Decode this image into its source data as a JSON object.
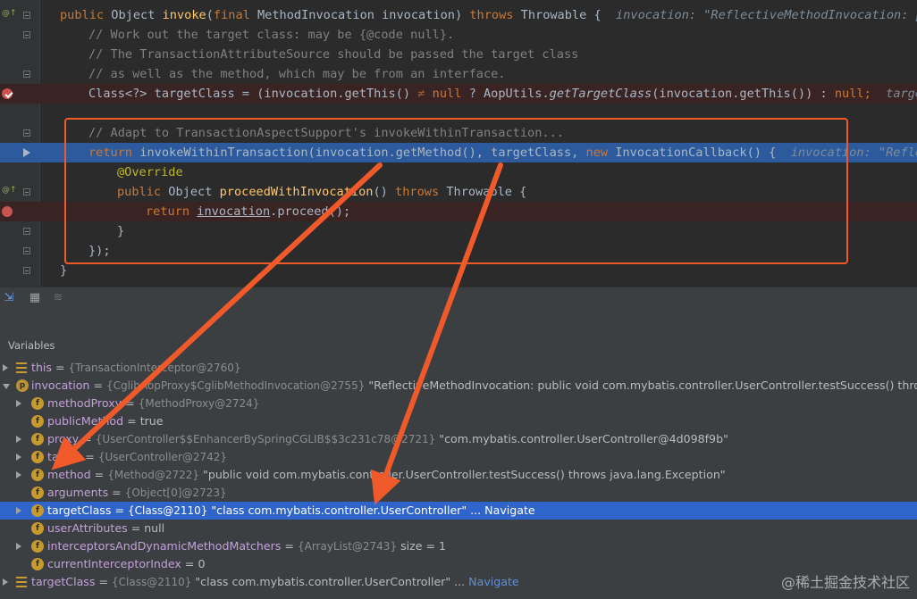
{
  "editor": {
    "lines": [
      {
        "id": "l1",
        "kw_public": "public",
        "type": " Object ",
        "method": "invoke",
        "open": "(",
        "kw_final": "final",
        "param": " MethodInvocation invocation) ",
        "kw_throws": "throws",
        "exc": " Throwable {",
        "hint": "  invocation: \"ReflectiveMethodInvocation: pub"
      },
      {
        "id": "l2",
        "text": "// Work out the target class: may be {@code null}."
      },
      {
        "id": "l3",
        "text": "// The TransactionAttributeSource should be passed the target class"
      },
      {
        "id": "l4",
        "text": "// as well as the method, which may be from an interface."
      },
      {
        "id": "l5",
        "a": "Class<?> targetClass = (invocation.getThis() ",
        "ne": "≠",
        "b": " ",
        "null": "null",
        "c": " ? AopUtils.",
        "m": "getTargetClass",
        "d": "(invocation.getThis()) : ",
        "null2": "null",
        "e": ";",
        "hint": "  targe"
      },
      {
        "id": "l6",
        "text": "// Adapt to TransactionAspectSupport's invokeWithinTransaction..."
      },
      {
        "id": "l7",
        "ret": "return",
        "a": " invokeWithinTransaction(invocation.getMethod(), targetClass, ",
        "kw_new": "new",
        "b": " InvocationCallback() {",
        "hint": "  invocation: \"Reflect"
      },
      {
        "id": "l8",
        "text": "@Override"
      },
      {
        "id": "l9",
        "kw_public": "public",
        "type": " Object ",
        "method": "proceedWithInvocation",
        "a": "() ",
        "kw_throws": "throws",
        "exc": " Throwable {"
      },
      {
        "id": "l10",
        "ret": "return",
        "sp": " ",
        "inv": "invocation",
        "a": ".proceed();"
      },
      {
        "id": "l11",
        "text": "}"
      },
      {
        "id": "l12",
        "text": "});"
      },
      {
        "id": "l13",
        "text": "}"
      }
    ]
  },
  "debug": {
    "variables_title": "Variables",
    "vars": [
      {
        "name": "this",
        "eq": " = ",
        "type": "{TransactionInterceptor@2760}",
        "value": ""
      },
      {
        "name": "invocation",
        "eq": " = ",
        "type": "{CglibAopProxy$CglibMethodInvocation@2755}",
        "value": " \"ReflectiveMethodInvocation: public void com.mybatis.controller.UserController.testSuccess() throws"
      },
      {
        "name": "methodProxy",
        "eq": " = ",
        "type": "{MethodProxy@2724}",
        "value": ""
      },
      {
        "name": "publicMethod",
        "eq": " = ",
        "type": "",
        "value": "true"
      },
      {
        "name": "proxy",
        "eq": " = ",
        "type": "{UserController$$EnhancerBySpringCGLIB$$3c231c78@2721}",
        "value": " \"com.mybatis.controller.UserController@4d098f9b\""
      },
      {
        "name": "target",
        "eq": " = ",
        "type": "{UserController@2742}",
        "value": ""
      },
      {
        "name": "method",
        "eq": " = ",
        "type": "{Method@2722}",
        "value": " \"public void com.mybatis.controller.UserController.testSuccess() throws java.lang.Exception\""
      },
      {
        "name": "arguments",
        "eq": " = ",
        "type": "{Object[0]@2723}",
        "value": ""
      },
      {
        "name": "targetClass",
        "eq": " = ",
        "type": "{Class@2110}",
        "value": " \"class com.mybatis.controller.UserController\" ...",
        "nav": " Navigate"
      },
      {
        "name": "userAttributes",
        "eq": " = ",
        "type": "",
        "value": "null"
      },
      {
        "name": "interceptorsAndDynamicMethodMatchers",
        "eq": " = ",
        "type": "{ArrayList@2743}",
        "value": "  size = 1"
      },
      {
        "name": "currentInterceptorIndex",
        "eq": " = ",
        "type": "",
        "value": "0"
      },
      {
        "name": "targetClass",
        "eq": " = ",
        "type": "{Class@2110}",
        "value": " \"class com.mybatis.controller.UserController\" ...",
        "nav": " Navigate"
      }
    ]
  },
  "watermark": "@稀土掘金技术社区",
  "colors": {
    "highlight": "#f05a2a",
    "selection": "#2f65ca",
    "exec_line": "#2d5a9c"
  }
}
